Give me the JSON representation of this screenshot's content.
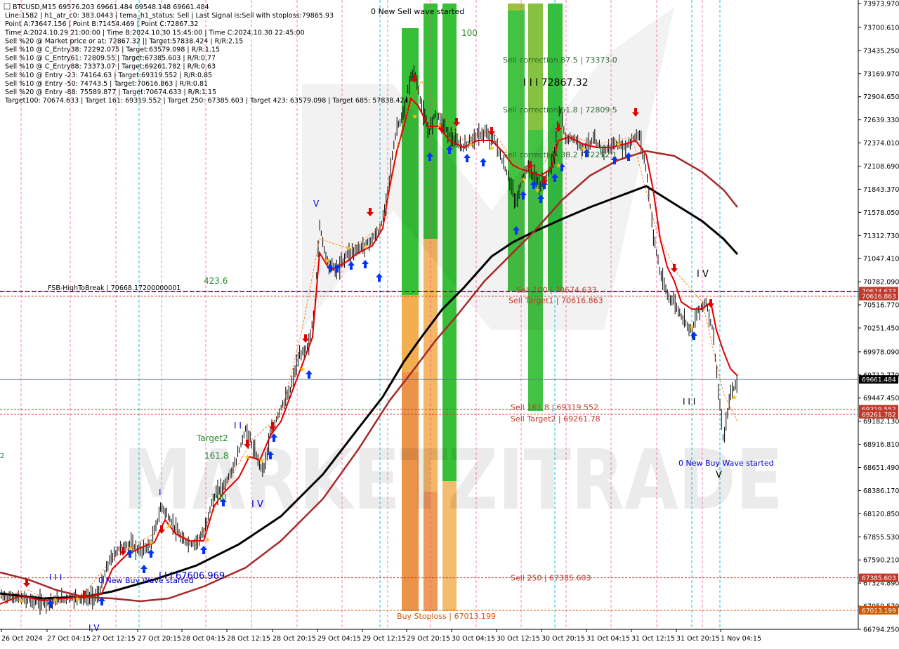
{
  "chart_data": {
    "type": "candlestick",
    "symbol": "BTCUSD,M15",
    "info_lines": [
      "BTCUSD,M15  69576.203 69661.484 69548.148 69661.484",
      "Line:1582 | h1_atr_c0: 383.0443 | tema_h1_status: Sell | Last Signal is:Sell with stoploss:79865.93",
      "Point A:73647.156 | Point B:71454.469 | Point C:72867.32",
      "Time A:2024.10.29 21:00:00 | Time B:2024.10.30 15:45:00 | Time C:2024.10.30 22:45:00",
      "Sell %20 @ Market price or at: 72867.32 || Target:57838.424 | R/R:2.15",
      "Sell %10 @ C_Entry38: 72292.075 | Target:63579.098 | R/R:1.15",
      "Sell %10 @ C_Entry61: 72809.55 | Target:67385.603 | R/R:0.77",
      "Sell %10 @ C_Entry88: 73373.07 | Target:69261.782 | R/R:0.63",
      "Sell %10 @ Entry -23: 74164.63 | Target:69319.552 | R/R:0.85",
      "Sell %10 @ Entry -50: 74743.5 | Target:70616.863 | R/R:0.81",
      "Sell %20 @ Entry -88: 75589.877 | Target:70674.633 | R/R:1.15",
      "Target100: 70674.633 | Target 161: 69319.552 | Target 250: 67385.603 | Target 423: 63579.098 | Target 685: 57838.424"
    ],
    "y_ticks": [
      "73973.970",
      "73700.610",
      "73435.250",
      "73169.970",
      "72904.650",
      "72639.330",
      "72374.010",
      "72108.690",
      "71843.370",
      "71578.050",
      "71312.730",
      "71047.410",
      "70782.090",
      "70516.770",
      "70251.450",
      "69978.090",
      "69712.770",
      "69447.450",
      "69182.130",
      "68916.810",
      "68651.490",
      "68386.170",
      "68120.850",
      "67855.530",
      "67590.210",
      "67324.890",
      "67059.570",
      "66794.250"
    ],
    "y_range": [
      66794.25,
      73973.97
    ],
    "x_ticks": [
      "26 Oct 2024",
      "27 Oct 04:15",
      "27 Oct 12:15",
      "27 Oct 20:15",
      "28 Oct 04:15",
      "28 Oct 12:15",
      "28 Oct 20:15",
      "29 Oct 04:15",
      "29 Oct 12:15",
      "29 Oct 20:15",
      "30 Oct 04:15",
      "30 Oct 12:15",
      "30 Oct 20:15",
      "31 Oct 04:15",
      "31 Oct 12:15",
      "31 Oct 20:15",
      "1 Nov 04:15"
    ],
    "price_boxes": [
      {
        "label": "70674.633",
        "value": 70674.633,
        "color": "#c0392b"
      },
      {
        "label": "70616.863",
        "value": 70616.863,
        "color": "#c0392b"
      },
      {
        "label": "69661.484",
        "value": 69661.484,
        "color": "#000000"
      },
      {
        "label": "69319.552",
        "value": 69319.552,
        "color": "#c0392b"
      },
      {
        "label": "69261.782",
        "value": 69261.782,
        "color": "#c0392b"
      },
      {
        "label": "67385.603",
        "value": 67385.603,
        "color": "#c0392b"
      },
      {
        "label": "67013.199",
        "value": 67013.199,
        "color": "#d35400"
      }
    ],
    "h_lines": [
      {
        "label": "FSB-HighToBreak | 70668.17200000001",
        "value": 70668.172,
        "color": "#00008b"
      },
      {
        "label": "Sell 100 | 70674.633",
        "value": 70674.633,
        "color": "#c0392b"
      },
      {
        "label": "Sell Target1 | 70616.863",
        "value": 70616.863,
        "color": "#c0392b"
      },
      {
        "label": "Sell 161.8 | 69319.552",
        "value": 69319.552,
        "color": "#c0392b"
      },
      {
        "label": "Sell Target2 | 69261.78",
        "value": 69261.782,
        "color": "#c0392b"
      },
      {
        "label": "Sell 250 | 67385.603",
        "value": 67385.603,
        "color": "#c0392b"
      },
      {
        "label": "Buy Stoploss | 67013.199",
        "value": 67013.199,
        "color": "#d35400"
      }
    ],
    "annotations": [
      {
        "text": "0 New Sell wave started",
        "color": "#000000"
      },
      {
        "text": "100",
        "color": "#2e8b2e"
      },
      {
        "text": "Sell correction 87.5 | 73373.0",
        "color": "#2e6b2e"
      },
      {
        "text": "I I I 72867.32",
        "color": "#000000"
      },
      {
        "text": "Sell correction 61.8 | 72809.5",
        "color": "#2e6b2e"
      },
      {
        "text": "Sell correction 38.2 | 72292.1",
        "color": "#2e6b2e"
      },
      {
        "text": "423.6",
        "color": "#2e8b2e"
      },
      {
        "text": "Target2",
        "color": "#2e8b2e"
      },
      {
        "text": "161.8",
        "color": "#2e8b2e"
      },
      {
        "text": "100",
        "color": "#2e8b2e"
      },
      {
        "text": "0 New Buy Wave started",
        "color": "#0000cd"
      },
      {
        "text": "I I I 67606.969",
        "color": "#0000cd"
      },
      {
        "text": "0 New Buy Wave started",
        "color": "#0000cd"
      },
      {
        "text": "I V",
        "color": "#0000cd"
      },
      {
        "text": "V",
        "color": "#0000cd"
      },
      {
        "text": "I I I",
        "color": "#0000cd"
      },
      {
        "text": "I I",
        "color": "#0000cd"
      },
      {
        "text": "I",
        "color": "#0000cd"
      },
      {
        "text": "I V",
        "color": "#0000cd"
      },
      {
        "text": "I V",
        "color": "#000000"
      },
      {
        "text": "I I I",
        "color": "#000000"
      },
      {
        "text": "V",
        "color": "#000000"
      }
    ],
    "watermark": "MARKETZITRADE",
    "colors": {
      "ma_black": "#000000",
      "ma_darkred": "#a52a2a",
      "tema": "#e00000",
      "bull_zone": "#22b822",
      "bear_zone": "#f0a030"
    }
  }
}
